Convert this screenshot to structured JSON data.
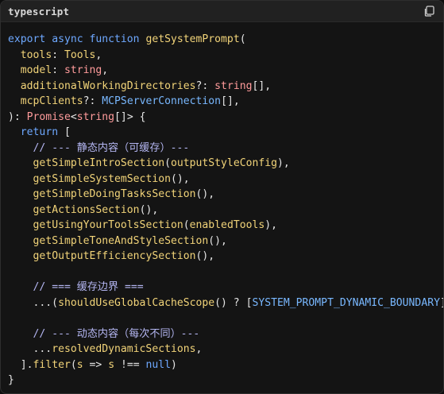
{
  "header": {
    "language": "typescript",
    "copy_icon": "copy-icon"
  },
  "code_lines": [
    [
      [
        "kw",
        "export "
      ],
      [
        "kw",
        "async "
      ],
      [
        "kw",
        "function "
      ],
      [
        "fn",
        "getSystemPrompt"
      ],
      [
        "pl",
        "("
      ]
    ],
    [
      [
        "pl",
        "  "
      ],
      [
        "pm",
        "tools"
      ],
      [
        "pl",
        ": "
      ],
      [
        "fn",
        "Tools"
      ],
      [
        "pl",
        ","
      ]
    ],
    [
      [
        "pl",
        "  "
      ],
      [
        "pm",
        "model"
      ],
      [
        "pl",
        ": "
      ],
      [
        "ptype",
        "string"
      ],
      [
        "pl",
        ","
      ]
    ],
    [
      [
        "pl",
        "  "
      ],
      [
        "pm",
        "additionalWorkingDirectories"
      ],
      [
        "pl",
        "?: "
      ],
      [
        "ptype",
        "string"
      ],
      [
        "pl",
        "[],"
      ]
    ],
    [
      [
        "pl",
        "  "
      ],
      [
        "pm",
        "mcpClients"
      ],
      [
        "pl",
        "?: "
      ],
      [
        "ty",
        "MCPServerConnection"
      ],
      [
        "pl",
        "[],"
      ]
    ],
    [
      [
        "pl",
        "): "
      ],
      [
        "ptype",
        "Promise"
      ],
      [
        "pl",
        "<"
      ],
      [
        "ptype",
        "string"
      ],
      [
        "pl",
        "[]> {"
      ]
    ],
    [
      [
        "pl",
        "  "
      ],
      [
        "kw",
        "return "
      ],
      [
        "pl",
        "["
      ]
    ],
    [
      [
        "pl",
        "    "
      ],
      [
        "cm",
        "// --- 静态内容（可缓存）---"
      ]
    ],
    [
      [
        "pl",
        "    "
      ],
      [
        "fn",
        "getSimpleIntroSection"
      ],
      [
        "pl",
        "("
      ],
      [
        "fn",
        "outputStyleConfig"
      ],
      [
        "pl",
        "),"
      ]
    ],
    [
      [
        "pl",
        "    "
      ],
      [
        "fn",
        "getSimpleSystemSection"
      ],
      [
        "pl",
        "(),"
      ]
    ],
    [
      [
        "pl",
        "    "
      ],
      [
        "fn",
        "getSimpleDoingTasksSection"
      ],
      [
        "pl",
        "(),"
      ]
    ],
    [
      [
        "pl",
        "    "
      ],
      [
        "fn",
        "getActionsSection"
      ],
      [
        "pl",
        "(),"
      ]
    ],
    [
      [
        "pl",
        "    "
      ],
      [
        "fn",
        "getUsingYourToolsSection"
      ],
      [
        "pl",
        "("
      ],
      [
        "fn",
        "enabledTools"
      ],
      [
        "pl",
        "),"
      ]
    ],
    [
      [
        "pl",
        "    "
      ],
      [
        "fn",
        "getSimpleToneAndStyleSection"
      ],
      [
        "pl",
        "(),"
      ]
    ],
    [
      [
        "pl",
        "    "
      ],
      [
        "fn",
        "getOutputEfficiencySection"
      ],
      [
        "pl",
        "(),"
      ]
    ],
    [
      [
        "pl",
        ""
      ]
    ],
    [
      [
        "pl",
        "    "
      ],
      [
        "cm",
        "// === 缓存边界 ==="
      ]
    ],
    [
      [
        "pl",
        "    ...("
      ],
      [
        "fn",
        "shouldUseGlobalCacheScope"
      ],
      [
        "pl",
        "() ? ["
      ],
      [
        "ty",
        "SYSTEM_PROMPT_DYNAMIC_BOUNDARY"
      ],
      [
        "pl",
        "] : []),"
      ]
    ],
    [
      [
        "pl",
        ""
      ]
    ],
    [
      [
        "pl",
        "    "
      ],
      [
        "cm",
        "// --- 动态内容（每次不同）---"
      ]
    ],
    [
      [
        "pl",
        "    ..."
      ],
      [
        "fn",
        "resolvedDynamicSections"
      ],
      [
        "pl",
        ","
      ]
    ],
    [
      [
        "pl",
        "  ]."
      ],
      [
        "fn",
        "filter"
      ],
      [
        "pl",
        "("
      ],
      [
        "pm",
        "s"
      ],
      [
        "pl",
        " => "
      ],
      [
        "pm",
        "s"
      ],
      [
        "pl",
        " !== "
      ],
      [
        "cn",
        "null"
      ],
      [
        "pl",
        ")"
      ]
    ],
    [
      [
        "pl",
        "}"
      ]
    ]
  ]
}
